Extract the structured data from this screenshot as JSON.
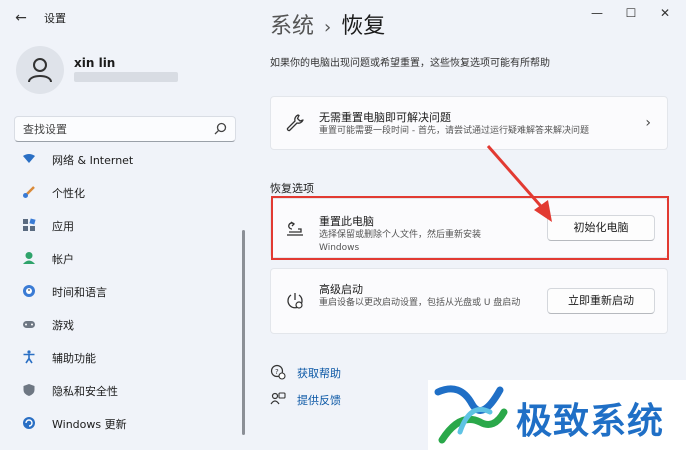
{
  "window": {
    "app_title": "设置",
    "back_glyph": "←",
    "min_glyph": "—",
    "max_glyph": "☐",
    "close_glyph": "✕"
  },
  "profile": {
    "name": "xin lin"
  },
  "search": {
    "placeholder": "查找设置"
  },
  "sidebar": {
    "items": [
      {
        "label": "网络 & Internet",
        "icon": "wifi-icon"
      },
      {
        "label": "个性化",
        "icon": "brush-icon"
      },
      {
        "label": "应用",
        "icon": "apps-icon"
      },
      {
        "label": "帐户",
        "icon": "account-icon"
      },
      {
        "label": "时间和语言",
        "icon": "globe-clock-icon"
      },
      {
        "label": "游戏",
        "icon": "gamepad-icon"
      },
      {
        "label": "辅助功能",
        "icon": "accessibility-icon"
      },
      {
        "label": "隐私和安全性",
        "icon": "shield-icon"
      },
      {
        "label": "Windows 更新",
        "icon": "update-icon"
      }
    ]
  },
  "main": {
    "breadcrumb_parent": "系统",
    "breadcrumb_sep": "›",
    "breadcrumb_current": "恢复",
    "description": "如果你的电脑出现问题或希望重置，这些恢复选项可能有所帮助",
    "fix_card": {
      "title": "无需重置电脑即可解决问题",
      "desc": "重置可能需要一段时间 - 首先，请尝试通过运行疑难解答来解决问题",
      "chevron": "›"
    },
    "section_title": "恢复选项",
    "reset_card": {
      "title": "重置此电脑",
      "desc": "选择保留或删除个人文件，然后重新安装 Windows",
      "button": "初始化电脑"
    },
    "advanced_card": {
      "title": "高级启动",
      "desc": "重启设备以更改启动设置，包括从光盘或 U 盘启动",
      "button": "立即重新启动"
    },
    "links": [
      {
        "label": "获取帮助",
        "icon": "help-icon"
      },
      {
        "label": "提供反馈",
        "icon": "feedback-icon"
      }
    ]
  },
  "watermark": {
    "text": "极致系统"
  },
  "colors": {
    "highlight": "#e23a32",
    "link": "#0a57a5",
    "watermark": "#1f6fc6"
  }
}
